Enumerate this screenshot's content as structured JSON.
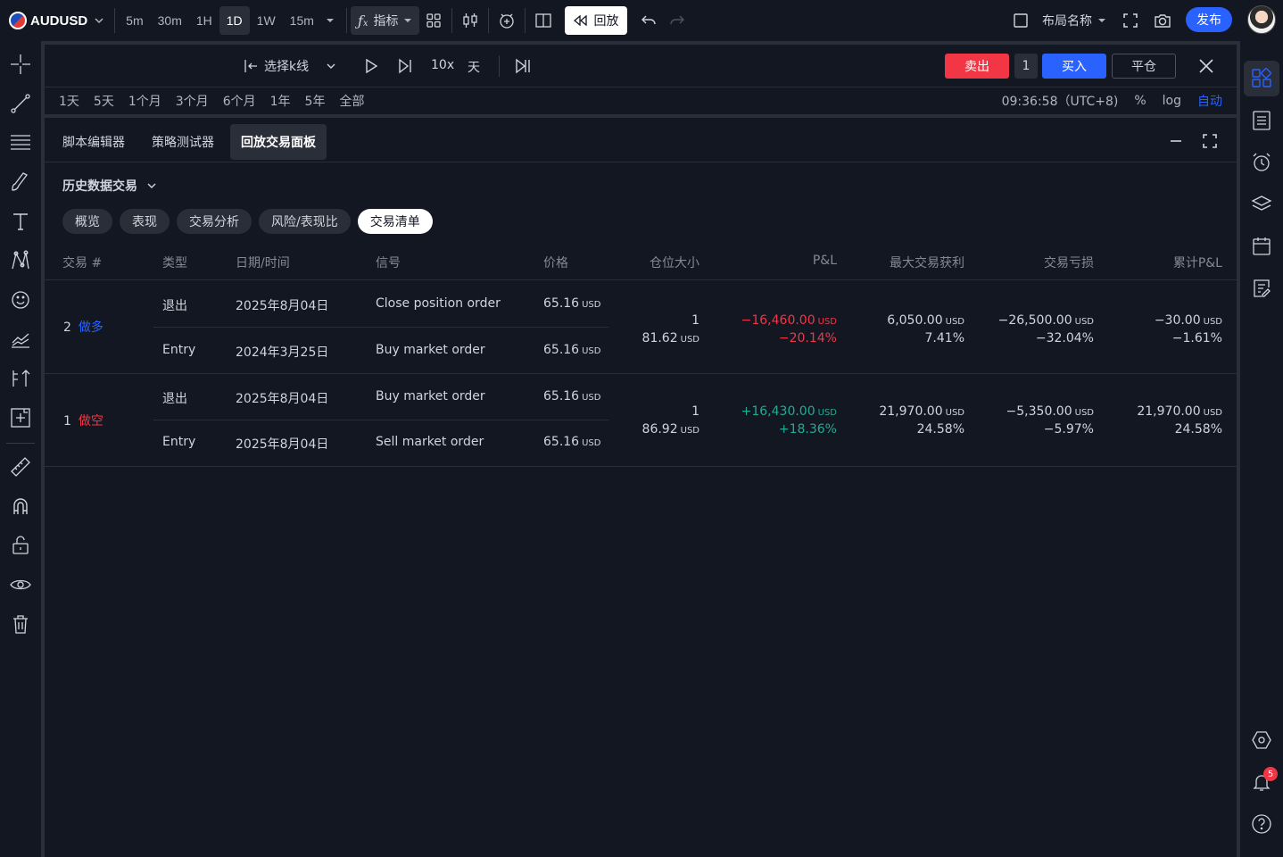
{
  "topbar": {
    "symbol": "AUDUSD",
    "timeframes": [
      "5m",
      "30m",
      "1H",
      "1D",
      "1W",
      "15m"
    ],
    "active_timeframe": "1D",
    "indicators_label": "指标",
    "replay_label": "回放",
    "layout_name": "布局名称",
    "publish_label": "发布"
  },
  "replay_bar": {
    "select_bar_label": "选择k线",
    "speed": "10x",
    "interval": "天",
    "sell_label": "卖出",
    "quantity": "1",
    "buy_label": "买入",
    "close_position_label": "平仓"
  },
  "range_bar": {
    "ranges": [
      "1天",
      "5天",
      "1个月",
      "3个月",
      "6个月",
      "1年",
      "5年",
      "全部"
    ],
    "time": "09:36:58（UTC+8)",
    "percent": "%",
    "log": "log",
    "auto": "自动"
  },
  "panel": {
    "tabs": [
      "脚本编辑器",
      "策略测试器",
      "回放交易面板"
    ],
    "active_tab": "回放交易面板",
    "history_title": "历史数据交易",
    "subtabs": [
      "概览",
      "表现",
      "交易分析",
      "风险/表现比",
      "交易清单"
    ],
    "active_subtab": "交易清单"
  },
  "table": {
    "headers": {
      "trade_no": "交易 #",
      "type": "类型",
      "datetime": "日期/时间",
      "signal": "信号",
      "price": "价格",
      "position_size": "仓位大小",
      "pnl": "P&L",
      "max_run_up": "最大交易获利",
      "drawdown": "交易亏损",
      "cum_pnl": "累计P&L"
    },
    "currency": "USD",
    "trades": [
      {
        "no": "2",
        "direction": "做多",
        "exit": {
          "type": "退出",
          "datetime": "2025年8月04日",
          "signal": "Close position order",
          "price": "65.16"
        },
        "entry": {
          "type": "Entry",
          "datetime": "2024年3月25日",
          "signal": "Buy market order",
          "price": "65.16"
        },
        "size_qty": "1",
        "size_value": "81.62",
        "pnl": "−16,460.00",
        "pnl_pct": "−20.14%",
        "run_up": "6,050.00",
        "run_up_pct": "7.41%",
        "drawdown": "−26,500.00",
        "drawdown_pct": "−32.04%",
        "cum_pnl": "−30.00",
        "cum_pnl_pct": "−1.61%"
      },
      {
        "no": "1",
        "direction": "做空",
        "exit": {
          "type": "退出",
          "datetime": "2025年8月04日",
          "signal": "Buy market order",
          "price": "65.16"
        },
        "entry": {
          "type": "Entry",
          "datetime": "2025年8月04日",
          "signal": "Sell market order",
          "price": "65.16"
        },
        "size_qty": "1",
        "size_value": "86.92",
        "pnl": "+16,430.00",
        "pnl_pct": "+18.36%",
        "run_up": "21,970.00",
        "run_up_pct": "24.58%",
        "drawdown": "−5,350.00",
        "drawdown_pct": "−5.97%",
        "cum_pnl": "21,970.00",
        "cum_pnl_pct": "24.58%"
      }
    ]
  },
  "notifications": {
    "count": "5"
  },
  "colors": {
    "background": "#131722",
    "accent": "#2962ff",
    "sell": "#f23645",
    "profit": "#22ab94"
  }
}
